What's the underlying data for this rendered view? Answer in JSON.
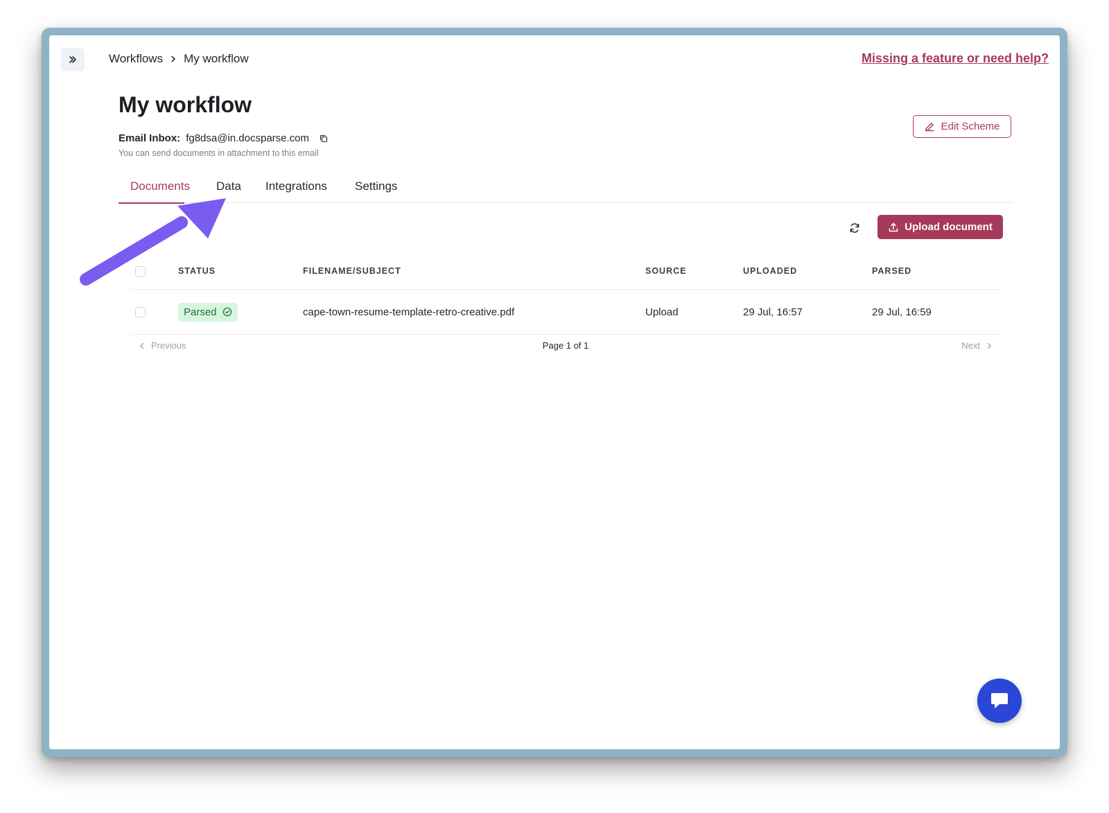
{
  "breadcrumb": {
    "root": "Workflows",
    "current": "My workflow"
  },
  "help_link": "Missing a feature or need help?",
  "page": {
    "title": "My workflow",
    "email_label": "Email Inbox:",
    "email_value": "fg8dsa@in.docsparse.com",
    "email_hint": "You can send documents in attachment to this email"
  },
  "edit_scheme_label": "Edit Scheme",
  "tabs": [
    {
      "label": "Documents",
      "active": true
    },
    {
      "label": "Data",
      "active": false
    },
    {
      "label": "Integrations",
      "active": false
    },
    {
      "label": "Settings",
      "active": false
    }
  ],
  "upload_label": "Upload document",
  "table": {
    "columns": [
      "STATUS",
      "FILENAME/SUBJECT",
      "SOURCE",
      "UPLOADED",
      "PARSED"
    ],
    "rows": [
      {
        "status": "Parsed",
        "filename": "cape-town-resume-template-retro-creative.pdf",
        "source": "Upload",
        "uploaded": "29 Jul, 16:57",
        "parsed": "29 Jul, 16:59"
      }
    ]
  },
  "pagination": {
    "previous": "Previous",
    "page_info": "Page 1 of 1",
    "next": "Next"
  },
  "colors": {
    "accent": "#a63a5b",
    "badge_bg": "#d6f5de",
    "annotation_arrow": "#7b5cf0",
    "chat_button": "#2a47d8",
    "frame": "#8eb3c6"
  },
  "icons": [
    "double-chevron-right-icon",
    "chevron-right-icon",
    "copy-icon",
    "pencil-icon",
    "refresh-icon",
    "upload-icon",
    "check-circle-icon",
    "chevron-left-icon",
    "chat-icon"
  ]
}
